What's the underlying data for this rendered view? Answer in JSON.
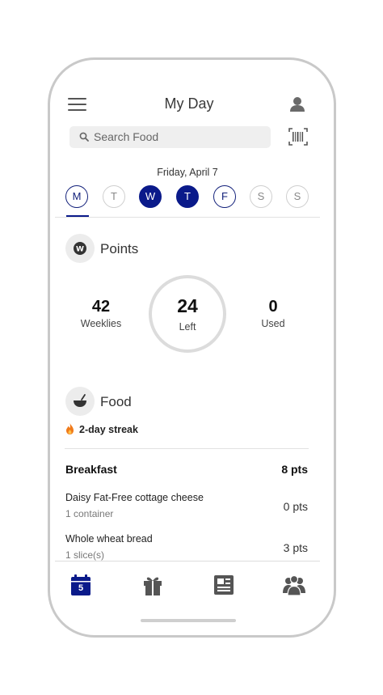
{
  "header": {
    "title": "My Day"
  },
  "search": {
    "placeholder": "Search Food"
  },
  "date": {
    "label": "Friday, April 7"
  },
  "days": [
    {
      "letter": "M",
      "state": "today"
    },
    {
      "letter": "T",
      "state": "future"
    },
    {
      "letter": "W",
      "state": "filled"
    },
    {
      "letter": "T",
      "state": "filled"
    },
    {
      "letter": "F",
      "state": "outlined"
    },
    {
      "letter": "S",
      "state": "future"
    },
    {
      "letter": "S",
      "state": "future"
    }
  ],
  "points": {
    "title": "Points",
    "weeklies_value": "42",
    "weeklies_label": "Weeklies",
    "left_value": "24",
    "left_label": "Left",
    "used_value": "0",
    "used_label": "Used"
  },
  "food": {
    "title": "Food",
    "streak": "2-day streak",
    "meal": {
      "name": "Breakfast",
      "points": "8 pts"
    },
    "items": [
      {
        "name": "Daisy Fat-Free cottage cheese",
        "qty": "1 container",
        "points": "0 pts"
      },
      {
        "name": "Whole wheat bread",
        "qty": "1 slice(s)",
        "points": "3 pts"
      }
    ]
  },
  "tabbar": {
    "calendar_day": "5"
  },
  "colors": {
    "accent": "#0a1a8a",
    "divider": "#e2e2e2",
    "muted": "#777777"
  }
}
